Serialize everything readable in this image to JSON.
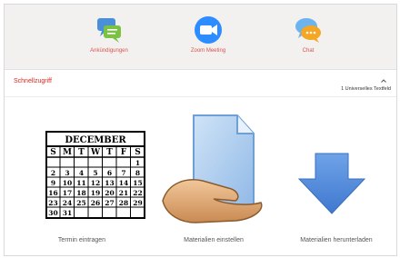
{
  "top_nav": {
    "items": [
      {
        "label": "Ankündigungen",
        "icon": "announcement-chat-icon"
      },
      {
        "label": "Zoom Meeting",
        "icon": "zoom-camera-icon"
      },
      {
        "label": "Chat",
        "icon": "chat-bubbles-icon"
      }
    ]
  },
  "section": {
    "title": "Schnellzugriff",
    "subtitle": "1 Universelles Textfeld"
  },
  "calendar": {
    "month": "DECEMBER",
    "weekdays": [
      "S",
      "M",
      "T",
      "W",
      "T",
      "F",
      "S"
    ]
  },
  "tiles": [
    {
      "label": "Termin eintragen",
      "icon": "calendar-icon"
    },
    {
      "label": "Materialien einstellen",
      "icon": "hand-document-icon"
    },
    {
      "label": "Materialien herunterladen",
      "icon": "download-arrow-icon"
    }
  ],
  "colors": {
    "accent_red": "#d9251d",
    "zoom_blue": "#2d8cff",
    "download_blue": "#4a86d8"
  }
}
